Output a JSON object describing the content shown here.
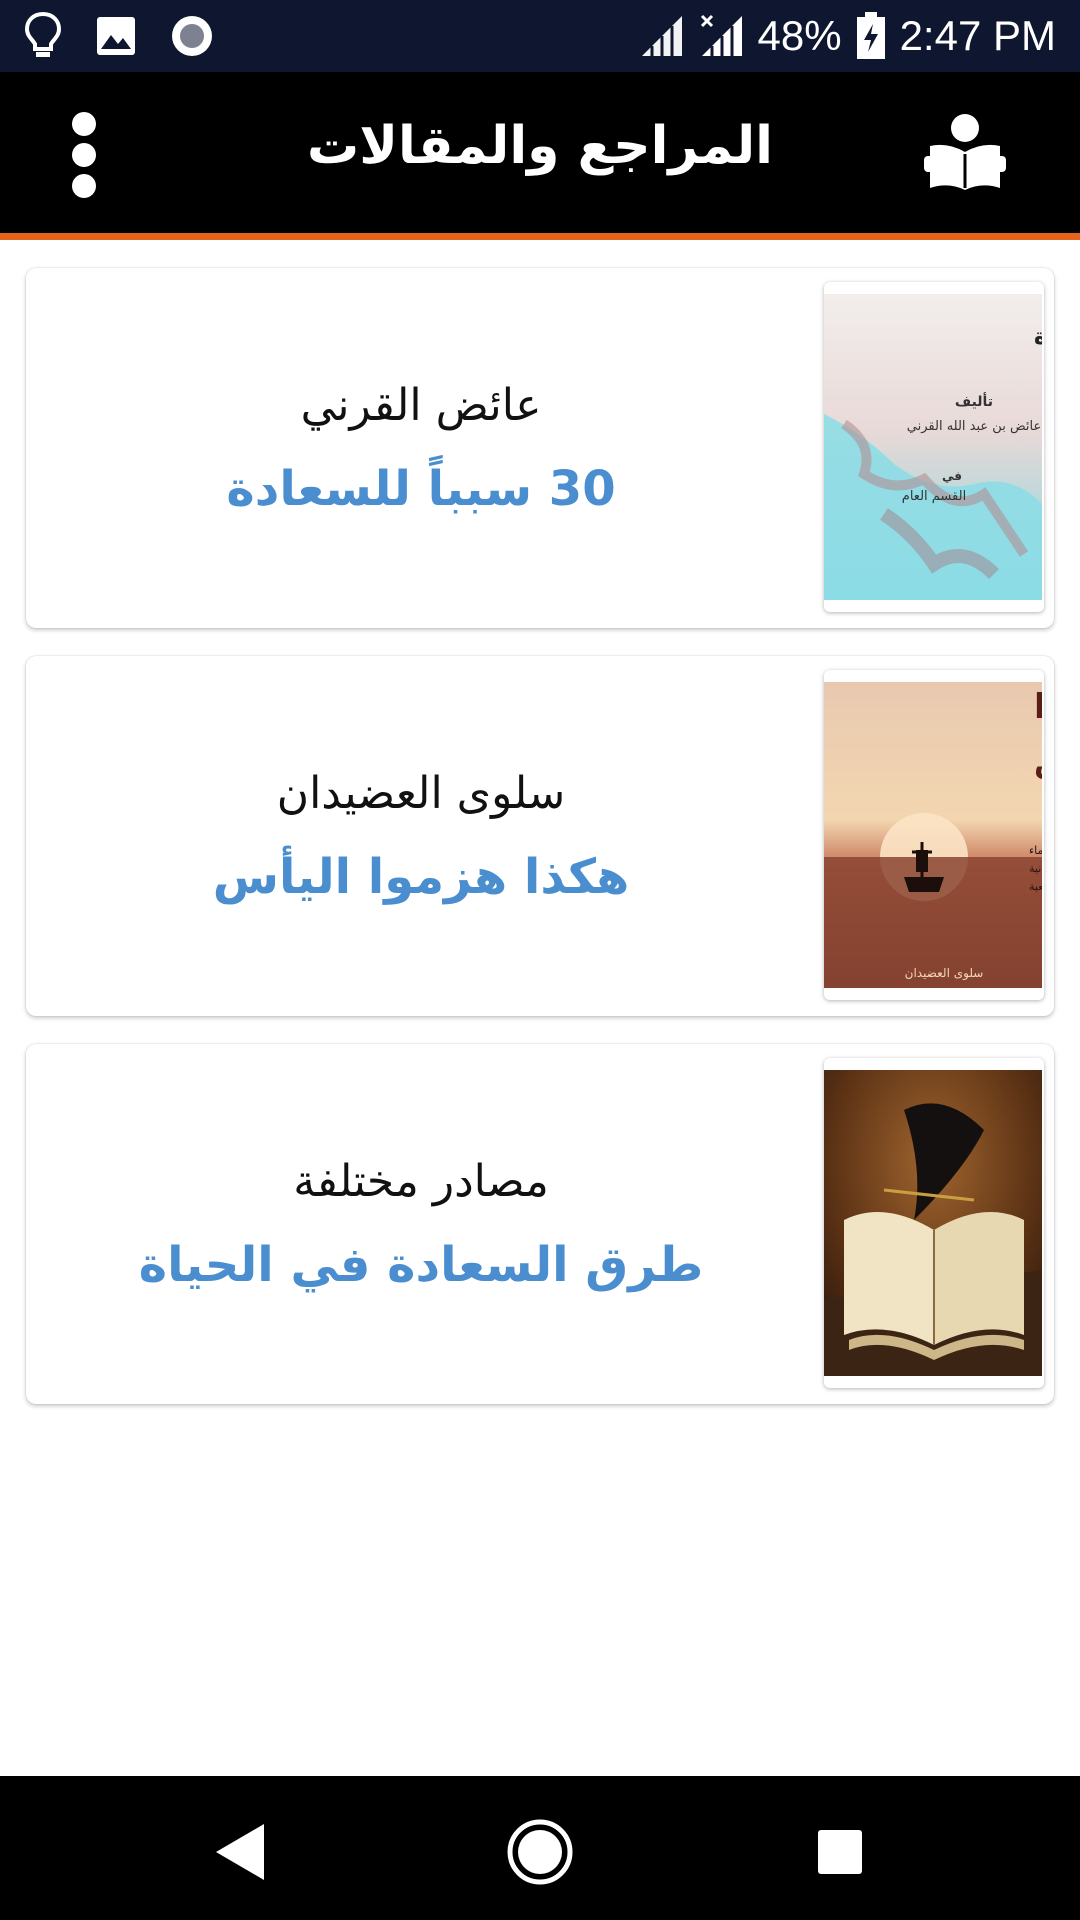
{
  "status_bar": {
    "battery": "48%",
    "time": "2:47 PM",
    "icons": [
      "lightbulb-icon",
      "image-icon",
      "record-icon",
      "signal-icon",
      "signal-no-data-icon",
      "battery-charging-icon"
    ]
  },
  "app_bar": {
    "title": "المراجع والمقالات",
    "menu_icon": "more-vert-icon",
    "logo_icon": "reading-person-icon"
  },
  "cards": [
    {
      "author": "عائض القرني",
      "title": "30 سبباً للسعادة",
      "cover": {
        "title": "ثلاثون سبب للسعادة",
        "line1": "تأليف",
        "line2": "عائض بن عبد الله القرني",
        "line3": "في",
        "line4": "القسم العام"
      }
    },
    {
      "author": "سلوى العضيدان",
      "title": "هكذا هزموا اليأس",
      "cover": {
        "title": "هكذا",
        "subtitle": "هزموا اليأس",
        "line1": "قصص علماء",
        "line2": "تجارب انسانية",
        "line3": "حكايات واقعية",
        "author": "سلوى العضيدان"
      }
    },
    {
      "author": "مصادر مختلفة",
      "title": "طرق السعادة في الحياة",
      "cover": {}
    }
  ],
  "nav_bar": {
    "back_icon": "back-triangle-icon",
    "home_icon": "home-circle-icon",
    "recents_icon": "recents-square-icon"
  },
  "colors": {
    "accent": "#e6631a",
    "title_blue": "#4a8ed0",
    "status_bar": "#0f1630"
  }
}
